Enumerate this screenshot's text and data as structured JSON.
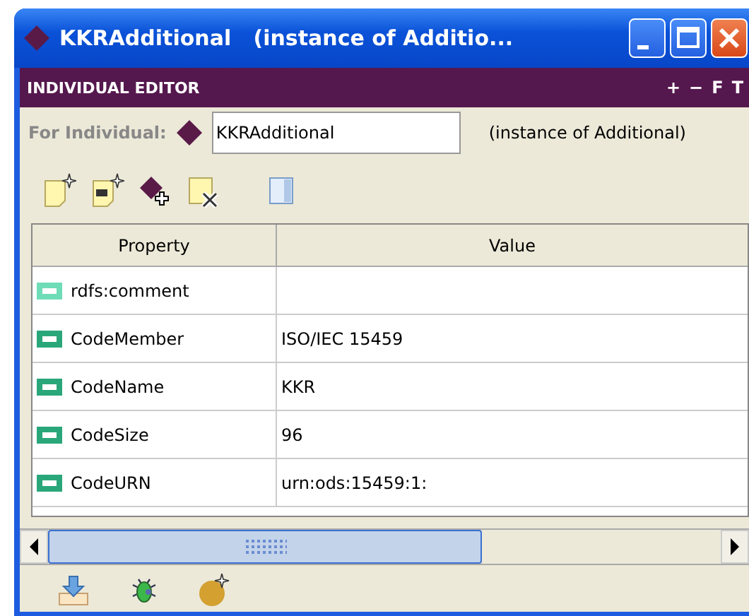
{
  "window": {
    "title": "KKRAdditional   (instance of Additio..."
  },
  "panel": {
    "title": "INDIVIDUAL EDITOR",
    "header_buttons": [
      "+",
      "−",
      "F",
      "T"
    ]
  },
  "individual": {
    "label": "For Individual:",
    "value": "KKRAdditional",
    "type_text": "(instance of Additional)"
  },
  "table": {
    "columns": [
      "Property",
      "Value"
    ],
    "rows": [
      {
        "property": "rdfs:comment",
        "kind": "annotation"
      },
      {
        "property": "CodeMember",
        "kind": "datatype",
        "value": "ISO/IEC 15459"
      },
      {
        "property": "CodeName",
        "kind": "datatype",
        "value": "KKR"
      },
      {
        "property": "CodeSize",
        "kind": "datatype",
        "value": "96"
      },
      {
        "property": "CodeURN",
        "kind": "datatype",
        "value": "urn:ods:15459:1:"
      }
    ]
  }
}
